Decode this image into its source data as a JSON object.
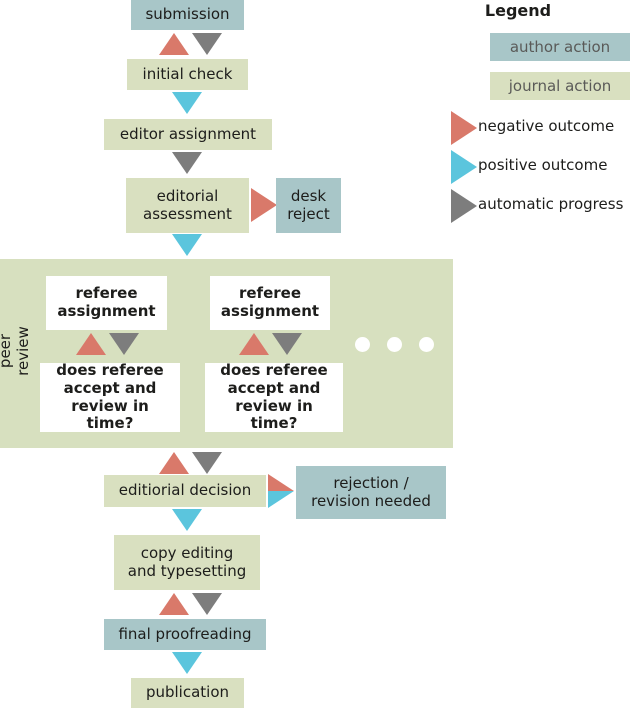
{
  "flow": {
    "nodes": [
      {
        "id": "submission",
        "label": "submission",
        "kind": "author"
      },
      {
        "id": "initial-check",
        "label": "initial check",
        "kind": "journal"
      },
      {
        "id": "editor-assignment",
        "label": "editor assignment",
        "kind": "journal"
      },
      {
        "id": "editorial-assessment",
        "label": "editorial\nassessment",
        "kind": "journal"
      },
      {
        "id": "desk-reject",
        "label": "desk\nreject",
        "kind": "author"
      },
      {
        "id": "referee-assignment-1",
        "label": "referee\nassignment",
        "kind": "white"
      },
      {
        "id": "referee-assignment-2",
        "label": "referee\nassignment",
        "kind": "white"
      },
      {
        "id": "referee-question-1",
        "label": "does referee\naccept and\nreview in time?",
        "kind": "white"
      },
      {
        "id": "referee-question-2",
        "label": "does referee\naccept and\nreview in time?",
        "kind": "white"
      },
      {
        "id": "editorial-decision",
        "label": "editiorial decision",
        "kind": "journal"
      },
      {
        "id": "rejection-revision",
        "label": "rejection /\nrevision needed",
        "kind": "author"
      },
      {
        "id": "copy-editing",
        "label": "copy editing\nand typesetting",
        "kind": "journal"
      },
      {
        "id": "final-proofreading",
        "label": "final proofreading",
        "kind": "author"
      },
      {
        "id": "publication",
        "label": "publication",
        "kind": "journal"
      }
    ],
    "peer_review_label": "peer review",
    "ellipsis_dots": 3
  },
  "legend": {
    "title": "Legend",
    "swatches": [
      {
        "label": "author action",
        "color": "#a8c6c8"
      },
      {
        "label": "journal action",
        "color": "#d9e0c0"
      }
    ],
    "markers": [
      {
        "label": "negative outcome",
        "color": "#d9796a",
        "icon": "triangle-right-icon"
      },
      {
        "label": "positive outcome",
        "color": "#5bc5dd",
        "icon": "triangle-right-icon"
      },
      {
        "label": "automatic progress",
        "color": "#7d7d7d",
        "icon": "triangle-right-icon"
      }
    ]
  },
  "colors": {
    "author_action": "#a8c6c8",
    "journal_action": "#d9e0c0",
    "peer_review_panel": "#d7e0bf",
    "negative": "#d9796a",
    "positive": "#5bc5dd",
    "automatic": "#7d7d7d",
    "text": "#1d1d1b"
  }
}
